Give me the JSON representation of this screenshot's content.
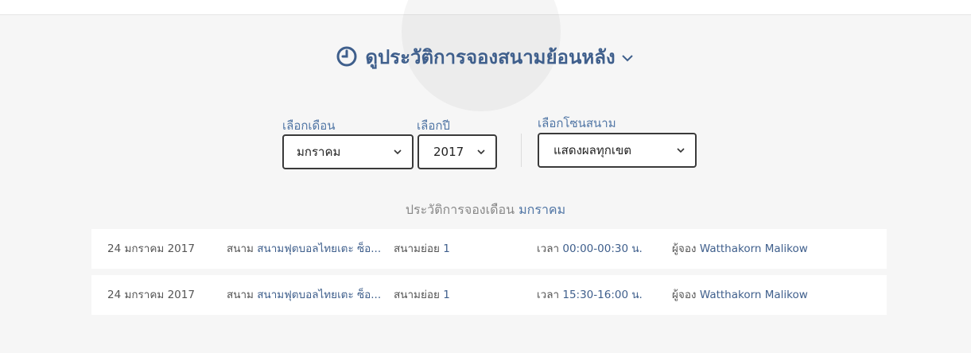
{
  "header": {
    "title": "ดูประวัติการจองสนามย้อนหลัง",
    "title_icon": "clock-icon",
    "toggle_icon": "chevron-down-icon"
  },
  "filters": {
    "month_label": "เลือกเดือน",
    "month_value": "มกราคม",
    "year_label": "เลือกปี",
    "year_value": "2017",
    "zone_label": "เลือกโซนสนาม",
    "zone_value": "แสดงผลทุกเขต"
  },
  "history": {
    "title_prefix": "ประวัติการจองเดือน",
    "month": "มกราคม",
    "rows": [
      {
        "date": "24 มกราคม 2017",
        "field_prefix": "สนาม",
        "field_name": "สนามฟุตบอลไทยเตะ ซ็อ...",
        "subfield_prefix": "สนามย่อย",
        "subfield": "1",
        "time_prefix": "เวลา",
        "time": "00:00-00:30 น.",
        "booker_prefix": "ผู้จอง",
        "booker": "Watthakorn Malikow"
      },
      {
        "date": "24 มกราคม 2017",
        "field_prefix": "สนาม",
        "field_name": "สนามฟุตบอลไทยเตะ ซ็อ...",
        "subfield_prefix": "สนามย่อย",
        "subfield": "1",
        "time_prefix": "เวลา",
        "time": "15:30-16:00 น.",
        "booker_prefix": "ผู้จอง",
        "booker": "Watthakorn Malikow"
      }
    ]
  },
  "colors": {
    "accent": "#3f5f8c",
    "label_blue": "#5176a5",
    "background": "#f6f6f6",
    "card": "#ffffff"
  }
}
